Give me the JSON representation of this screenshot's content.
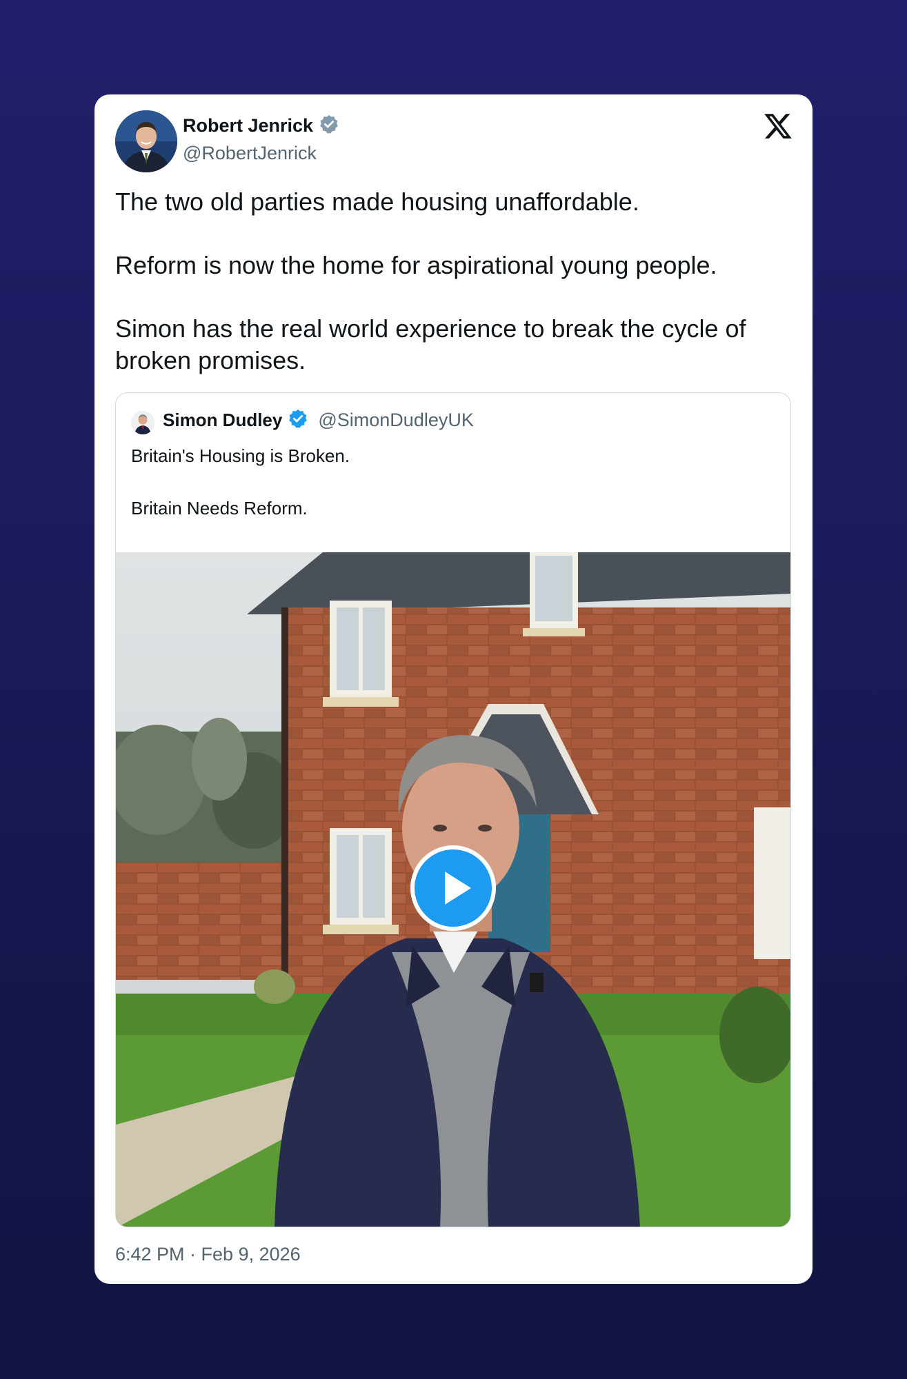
{
  "author": {
    "name": "Robert Jenrick",
    "handle": "@RobertJenrick",
    "verified_badge_color": "#829aab"
  },
  "tweet": {
    "text": "The two old parties made housing unaffordable.\n\nReform is now the home for aspirational young people.\n\nSimon has the real world experience to break the cycle of broken promises.",
    "timestamp": "6:42 PM · Feb 9, 2026"
  },
  "quoted_tweet": {
    "name": "Simon Dudley",
    "handle": "@SimonDudleyUK",
    "verified_badge_color": "#1d9bf0",
    "text": "Britain's Housing is Broken.\n\nBritain Needs Reform.",
    "media": {
      "type": "video",
      "play_button_color": "#1d9bf0"
    }
  },
  "platform": {
    "logo_icon": "x-logo-icon"
  },
  "colors": {
    "background_top": "#231f6b",
    "background_bottom": "#111340",
    "card": "#ffffff"
  }
}
